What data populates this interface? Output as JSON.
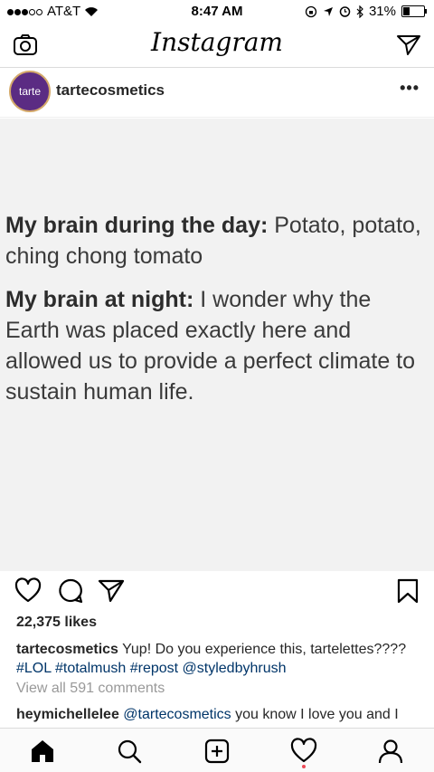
{
  "status_bar": {
    "carrier": "AT&T",
    "time": "8:47 AM",
    "battery": "31%",
    "battery_level": 0.31
  },
  "app": {
    "title": "Instagram"
  },
  "post": {
    "username": "tartecosmetics",
    "avatar_text": "tarte",
    "text": {
      "day_label": "My brain during the day:",
      "day_text": " Potato, potato, ching chong tomato",
      "night_label": "My brain at night:",
      "night_text": " I wonder why the Earth was placed exactly here and allowed us to provide a perfect climate to sustain human life."
    },
    "likes": "22,375 likes",
    "caption": {
      "username": "tartecosmetics",
      "text": " Yup! Do you experience this, tartelettes????",
      "tags": [
        " #LOL",
        " #totalmush",
        " #repost",
        " @styledbyhrush"
      ]
    },
    "view_all": "View all 591 comments",
    "comment": {
      "username": "heymichellelee",
      "mention": " @tartecosmetics",
      "text": " you know I love you and I"
    }
  },
  "colors": {
    "avatar_bg": "#5b2c83",
    "link": "#003569",
    "muted": "#999999",
    "notification": "#ed4956"
  },
  "icons": [
    "camera-icon",
    "send-icon",
    "heart-icon",
    "comment-icon",
    "share-icon",
    "bookmark-icon",
    "home-icon",
    "search-icon",
    "add-icon",
    "activity-icon",
    "profile-icon"
  ]
}
